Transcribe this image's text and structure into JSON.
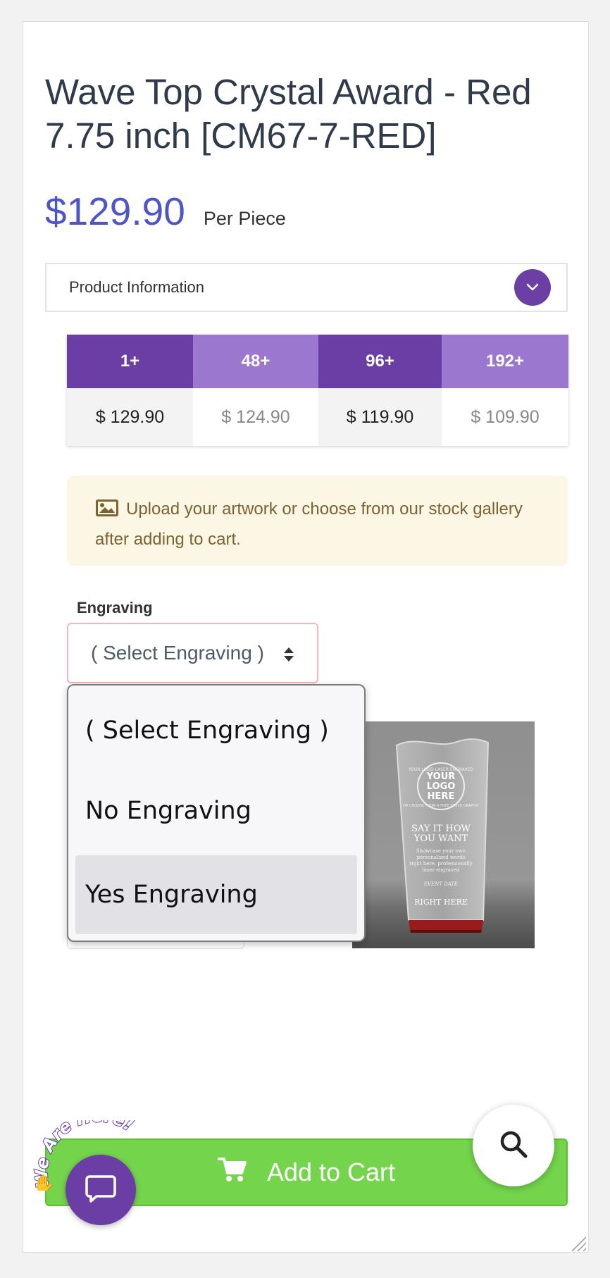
{
  "product": {
    "title": "Wave Top Crystal Award - Red 7.75 inch [CM67-7-RED]",
    "price": "$129.90",
    "price_unit": "Per Piece",
    "accent_color": "#4d55c8"
  },
  "accordion": {
    "label": "Product Information",
    "icon": "chevron-down-icon"
  },
  "pricing_tiers": [
    {
      "qty": "1+",
      "price": "$ 129.90"
    },
    {
      "qty": "48+",
      "price": "$ 124.90"
    },
    {
      "qty": "96+",
      "price": "$ 119.90"
    },
    {
      "qty": "192+",
      "price": "$ 109.90"
    }
  ],
  "notice": {
    "icon": "image-icon",
    "text": "Upload your artwork or choose from our stock gallery after adding to cart."
  },
  "engraving": {
    "label": "Engraving",
    "selected": "( Select Engraving )",
    "options": [
      "( Select Engraving )",
      "No Engraving",
      "Yes Engraving"
    ],
    "highlighted_index": 2
  },
  "product_image": {
    "circle_top": "YOUR LOGO LASER ENGRAVED",
    "circle_bottom": "OR CHOOSE FROM A FREE STOCK GRAPHIC",
    "logo_line1": "YOUR",
    "logo_line2": "LOGO",
    "logo_line3": "HERE",
    "headline1": "SAY IT HOW",
    "headline2": "YOU WANT",
    "body1": "Showcase your own",
    "body2": "personalized words",
    "body3": "right here, professionally",
    "body4": "laser engraved",
    "event": "EVENT DATE",
    "footer": "RIGHT HERE"
  },
  "cart": {
    "label": "Add to Cart",
    "color": "#74d44b"
  },
  "chat": {
    "tag": "We Are Here!",
    "color": "#6a3ea5"
  }
}
